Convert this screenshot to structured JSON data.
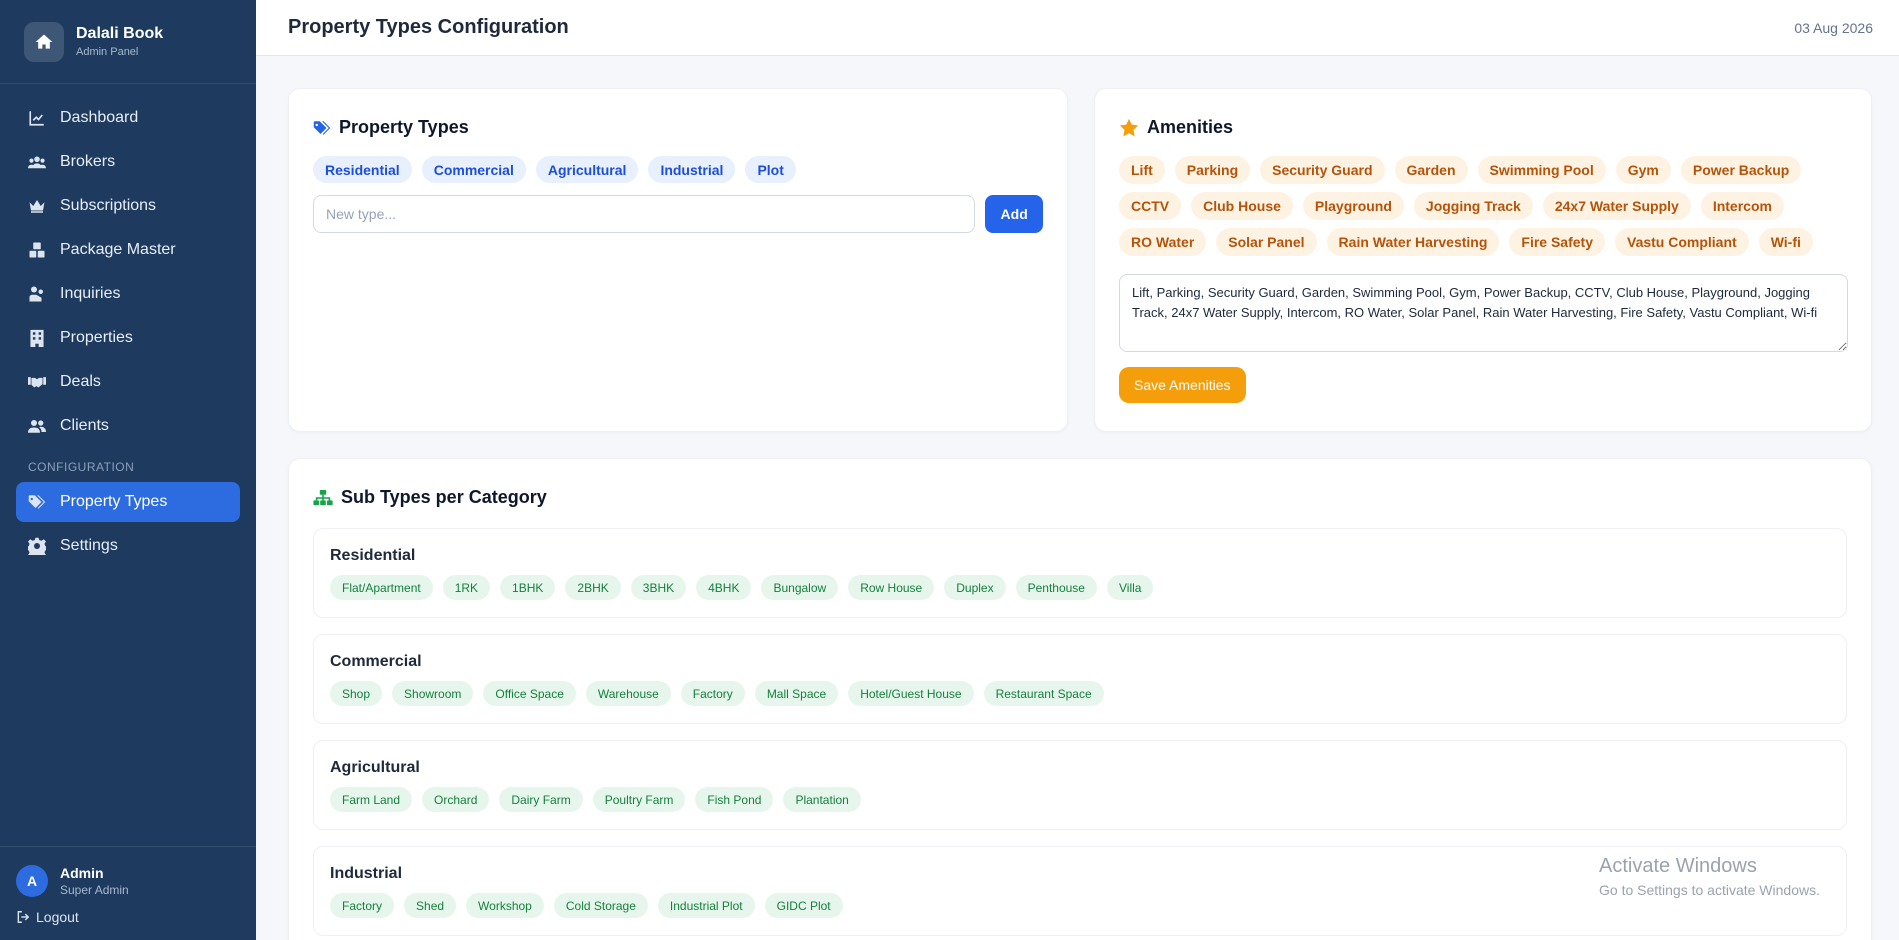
{
  "brand": {
    "name": "Dalali Book",
    "subtitle": "Admin Panel"
  },
  "nav": {
    "items": [
      {
        "label": "Dashboard",
        "icon": "chart-line-icon"
      },
      {
        "label": "Brokers",
        "icon": "users-icon"
      },
      {
        "label": "Subscriptions",
        "icon": "crown-icon"
      },
      {
        "label": "Package Master",
        "icon": "boxes-icon"
      },
      {
        "label": "Inquiries",
        "icon": "hand-coin-icon"
      },
      {
        "label": "Properties",
        "icon": "building-icon"
      },
      {
        "label": "Deals",
        "icon": "handshake-icon"
      },
      {
        "label": "Clients",
        "icon": "user-group-icon"
      }
    ],
    "section_label": "CONFIGURATION",
    "config_items": [
      {
        "label": "Property Types",
        "icon": "tags-icon",
        "active": true
      },
      {
        "label": "Settings",
        "icon": "gear-icon"
      }
    ]
  },
  "user": {
    "initial": "A",
    "name": "Admin",
    "role": "Super Admin",
    "logout_label": "Logout"
  },
  "header": {
    "title": "Property Types Configuration",
    "date": "03 Aug 2026"
  },
  "property_types": {
    "title": "Property Types",
    "chips": [
      "Residential",
      "Commercial",
      "Agricultural",
      "Industrial",
      "Plot"
    ],
    "input_placeholder": "New type...",
    "add_label": "Add"
  },
  "amenities": {
    "title": "Amenities",
    "chips": [
      "Lift",
      "Parking",
      "Security Guard",
      "Garden",
      "Swimming Pool",
      "Gym",
      "Power Backup",
      "CCTV",
      "Club House",
      "Playground",
      "Jogging Track",
      "24x7 Water Supply",
      "Intercom",
      "RO Water",
      "Solar Panel",
      "Rain Water Harvesting",
      "Fire Safety",
      "Vastu Compliant",
      "Wi-fi"
    ],
    "textarea_value": "Lift, Parking, Security Guard, Garden, Swimming Pool, Gym, Power Backup, CCTV, Club House, Playground, Jogging Track, 24x7 Water Supply, Intercom, RO Water, Solar Panel, Rain Water Harvesting, Fire Safety, Vastu Compliant, Wi-fi",
    "save_label": "Save Amenities"
  },
  "sub_types": {
    "title": "Sub Types per Category",
    "categories": [
      {
        "name": "Residential",
        "items": [
          "Flat/Apartment",
          "1RK",
          "1BHK",
          "2BHK",
          "3BHK",
          "4BHK",
          "Bungalow",
          "Row House",
          "Duplex",
          "Penthouse",
          "Villa"
        ]
      },
      {
        "name": "Commercial",
        "items": [
          "Shop",
          "Showroom",
          "Office Space",
          "Warehouse",
          "Factory",
          "Mall Space",
          "Hotel/Guest House",
          "Restaurant Space"
        ]
      },
      {
        "name": "Agricultural",
        "items": [
          "Farm Land",
          "Orchard",
          "Dairy Farm",
          "Poultry Farm",
          "Fish Pond",
          "Plantation"
        ]
      },
      {
        "name": "Industrial",
        "items": [
          "Factory",
          "Shed",
          "Workshop",
          "Cold Storage",
          "Industrial Plot",
          "GIDC Plot"
        ]
      }
    ]
  },
  "watermark": {
    "line1": "Activate Windows",
    "line2": "Go to Settings to activate Windows."
  },
  "colors": {
    "sidebar": "#1e3a5f",
    "accent": "#2563eb",
    "amber": "#f59e0b",
    "green": "#15803d"
  }
}
